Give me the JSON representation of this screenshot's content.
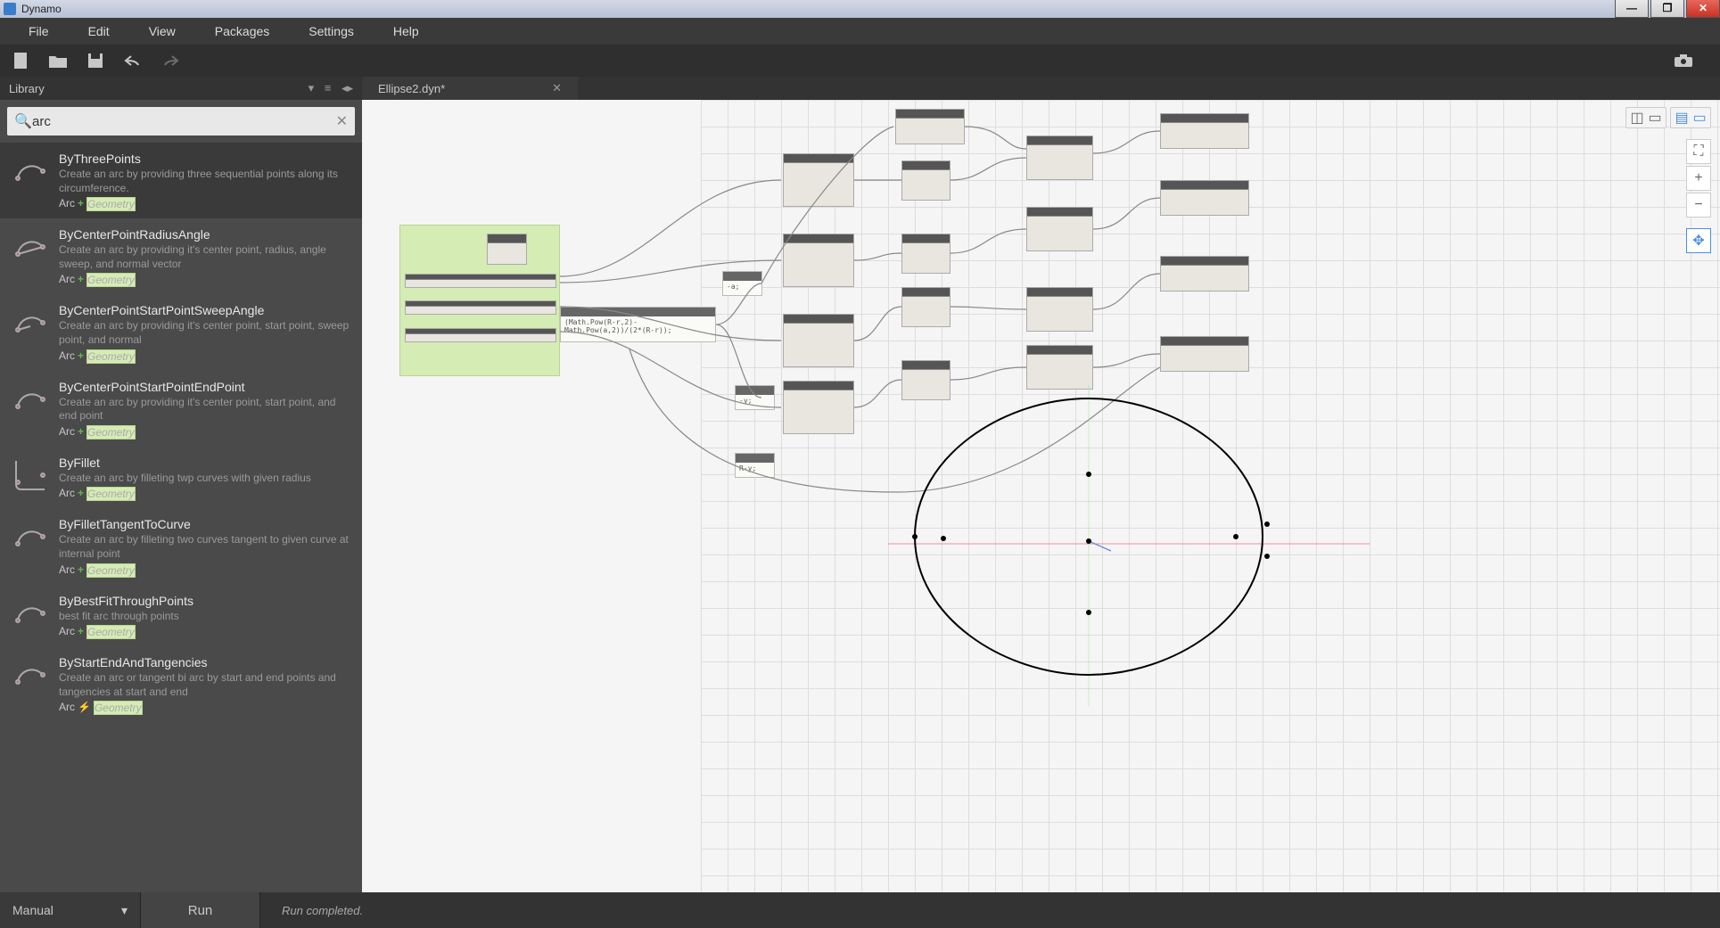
{
  "window": {
    "title": "Dynamo"
  },
  "menu": {
    "items": [
      "File",
      "Edit",
      "View",
      "Packages",
      "Settings",
      "Help"
    ]
  },
  "library": {
    "header": "Library"
  },
  "search": {
    "placeholder": "",
    "value": "arc"
  },
  "results": [
    {
      "title": "ByThreePoints",
      "desc": "Create an arc by providing three sequential points along its circumference.",
      "cat": "Arc",
      "sep": "plus",
      "grp": "Geometry"
    },
    {
      "title": "ByCenterPointRadiusAngle",
      "desc": "Create an arc by providing it's center point, radius, angle sweep, and normal vector",
      "cat": "Arc",
      "sep": "plus",
      "grp": "Geometry"
    },
    {
      "title": "ByCenterPointStartPointSweepAngle",
      "desc": "Create an arc by providing it's center point, start point, sweep point, and normal",
      "cat": "Arc",
      "sep": "plus",
      "grp": "Geometry"
    },
    {
      "title": "ByCenterPointStartPointEndPoint",
      "desc": "Create an arc by providing it's center point, start point, and end point",
      "cat": "Arc",
      "sep": "plus",
      "grp": "Geometry"
    },
    {
      "title": "ByFillet",
      "desc": "Create an arc by filleting twp curves with given radius",
      "cat": "Arc",
      "sep": "plus",
      "grp": "Geometry"
    },
    {
      "title": "ByFilletTangentToCurve",
      "desc": "Create an arc by filleting two curves tangent to given curve at internal point",
      "cat": "Arc",
      "sep": "plus",
      "grp": "Geometry"
    },
    {
      "title": "ByBestFitThroughPoints",
      "desc": "best fit arc through points",
      "cat": "Arc",
      "sep": "plus",
      "grp": "Geometry"
    },
    {
      "title": "ByStartEndAndTangencies",
      "desc": "Create an arc or tangent bi arc by start and end points and tangencies at start and end",
      "cat": "Arc",
      "sep": "bolt",
      "grp": "Geometry"
    }
  ],
  "tab": {
    "label": "Ellipse2.dyn*"
  },
  "codeblocks": {
    "a": "-a;",
    "b": "(Math.Pow(R-r,2)-Math.Pow(a,2))/(2*(R-r));",
    "c": "-y;",
    "d": "R-y;"
  },
  "run": {
    "mode": "Manual",
    "button": "Run",
    "status": "Run completed."
  }
}
